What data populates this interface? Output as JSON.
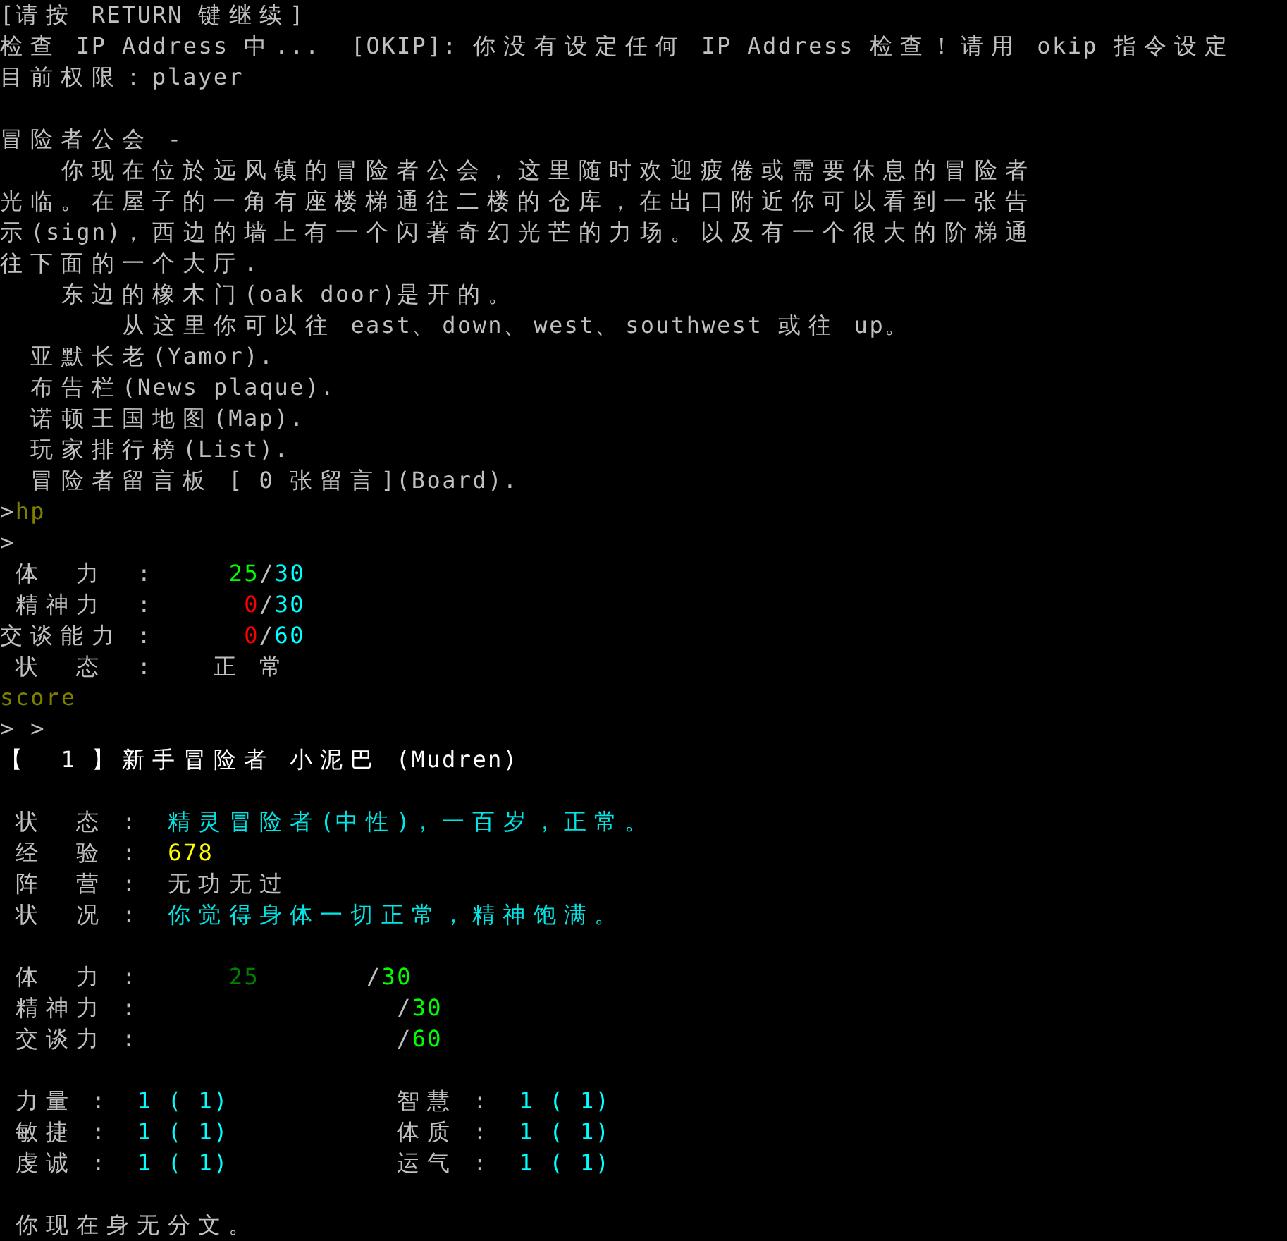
{
  "blocks": [
    {
      "lines": [
        {
          "segments": [
            {
              "text": "[请按 RETURN 键继续]"
            }
          ]
        },
        {
          "segments": [
            {
              "text": "检查 IP Address 中...  [OKIP]: 你没有设定任何 IP Address 检查！请用 okip 指令设定"
            }
          ]
        },
        {
          "segments": [
            {
              "text": "目前权限：player"
            }
          ]
        }
      ]
    },
    {
      "lines": [
        {
          "segments": [
            {
              "text": "冒险者公会 -"
            }
          ]
        },
        {
          "segments": [
            {
              "text": "    你现在位於远风镇的冒险者公会，这里随时欢迎疲倦或需要休息的冒险者"
            }
          ]
        },
        {
          "segments": [
            {
              "text": "光临。在屋子的一角有座楼梯通往二楼的仓库，在出口附近你可以看到一张告"
            }
          ]
        },
        {
          "segments": [
            {
              "text": "示(sign)，西边的墙上有一个闪著奇幻光芒的力场。以及有一个很大的阶梯通"
            }
          ]
        },
        {
          "segments": [
            {
              "text": "往下面的一个大厅."
            }
          ]
        },
        {
          "segments": [
            {
              "text": "    东边的橡木门(oak door)是开的。"
            }
          ]
        },
        {
          "segments": [
            {
              "text": "        从这里你可以往 east、down、west、southwest 或往 up。"
            }
          ]
        },
        {
          "segments": [
            {
              "text": "  亚默长老(Yamor)."
            }
          ]
        },
        {
          "segments": [
            {
              "text": "  布告栏(News plaque)."
            }
          ]
        },
        {
          "segments": [
            {
              "text": "  诺顿王国地图(Map)."
            }
          ]
        },
        {
          "segments": [
            {
              "text": "  玩家排行榜(List)."
            }
          ]
        },
        {
          "segments": [
            {
              "text": "  冒险者留言板 [ 0 张留言](Board)."
            }
          ]
        },
        {
          "segments": [
            {
              "text": ">"
            },
            {
              "text": "hp",
              "color": "#808000"
            }
          ]
        },
        {
          "segments": [
            {
              "text": ">"
            }
          ]
        },
        {
          "segments": [
            {
              "text": " 体  力  :     "
            },
            {
              "text": "25",
              "color": "#00ff00"
            },
            {
              "text": "/"
            },
            {
              "text": "30",
              "color": "#00ffff"
            }
          ]
        },
        {
          "segments": [
            {
              "text": " 精神力  :      "
            },
            {
              "text": "0",
              "color": "#ff0000"
            },
            {
              "text": "/"
            },
            {
              "text": "30",
              "color": "#00ffff"
            }
          ]
        },
        {
          "segments": [
            {
              "text": "交谈能力 :      "
            },
            {
              "text": "0",
              "color": "#ff0000"
            },
            {
              "text": "/"
            },
            {
              "text": "60",
              "color": "#00ffff"
            }
          ]
        },
        {
          "segments": [
            {
              "text": " 状  态  :    正 常"
            }
          ]
        },
        {
          "segments": [
            {
              "text": "score",
              "color": "#808000"
            }
          ]
        },
        {
          "segments": [
            {
              "text": "> >"
            }
          ]
        },
        {
          "segments": [
            {
              "text": "【  1 】新手冒险者 小泥巴 (Mudren)",
              "color": "#ffffff"
            }
          ]
        }
      ]
    },
    {
      "lines": [
        {
          "segments": [
            {
              "text": " 状  态 :  "
            },
            {
              "text": "精灵冒险者(中性)，一百岁，正常。",
              "color": "#00e5e5"
            }
          ]
        },
        {
          "segments": [
            {
              "text": " 经  验 :  "
            },
            {
              "text": "678",
              "color": "#ffff00"
            }
          ]
        },
        {
          "segments": [
            {
              "text": " 阵  营 :  无功无过"
            }
          ]
        },
        {
          "segments": [
            {
              "text": " 状  况 :  "
            },
            {
              "text": "你觉得身体一切正常，精神饱满。",
              "color": "#00e5e5"
            }
          ]
        }
      ]
    },
    {
      "lines": [
        {
          "segments": [
            {
              "text": " 体  力 :      "
            },
            {
              "text": "25",
              "color": "#008000"
            },
            {
              "text": "       /"
            },
            {
              "text": "30",
              "color": "#00ff00"
            }
          ]
        },
        {
          "segments": [
            {
              "text": " 精神力 :                 /"
            },
            {
              "text": "30",
              "color": "#00ff00"
            }
          ]
        },
        {
          "segments": [
            {
              "text": " 交谈力 :                 /"
            },
            {
              "text": "60",
              "color": "#00ff00"
            }
          ]
        }
      ]
    },
    {
      "lines": [
        {
          "segments": [
            {
              "text": " 力量 :  "
            },
            {
              "text": "1 ( 1)",
              "color": "#00ffff"
            },
            {
              "text": "           智慧 :  "
            },
            {
              "text": "1 ( 1)",
              "color": "#00ffff"
            }
          ]
        },
        {
          "segments": [
            {
              "text": " 敏捷 :  "
            },
            {
              "text": "1 ( 1)",
              "color": "#00ffff"
            },
            {
              "text": "           体质 :  "
            },
            {
              "text": "1 ( 1)",
              "color": "#00ffff"
            }
          ]
        },
        {
          "segments": [
            {
              "text": " 虔诚 :  "
            },
            {
              "text": "1 ( 1)",
              "color": "#00ffff"
            },
            {
              "text": "           运气 :  "
            },
            {
              "text": "1 ( 1)",
              "color": "#00ffff"
            }
          ]
        }
      ]
    },
    {
      "lines": [
        {
          "segments": [
            {
              "text": " 你现在身无分文。"
            }
          ]
        }
      ]
    }
  ]
}
